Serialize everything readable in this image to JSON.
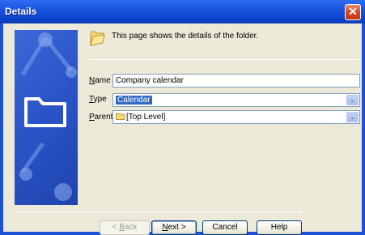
{
  "window": {
    "title": "Details",
    "close_glyph": "✕"
  },
  "header": {
    "description": "This page shows the details of the folder.",
    "icon": "folder-icon"
  },
  "form": {
    "name": {
      "label_accel": "N",
      "label_rest": "ame",
      "value": "Company calendar"
    },
    "type": {
      "label_accel": "T",
      "label_rest": "ype",
      "value": "Calendar"
    },
    "parent": {
      "label_accel": "P",
      "label_rest": "arent",
      "value": "[Top Level]"
    }
  },
  "buttons": {
    "back": {
      "prefix": "< ",
      "accel": "B",
      "rest": "ack"
    },
    "next": {
      "accel": "N",
      "rest": "ext >"
    },
    "cancel": "Cancel",
    "help": "Help"
  },
  "dropdown_glyph": "⌄",
  "colors": {
    "titlebar": "#1a55e0",
    "dialog_bg": "#ece9d8",
    "selection": "#316ac5",
    "field_border": "#7f9db9"
  }
}
